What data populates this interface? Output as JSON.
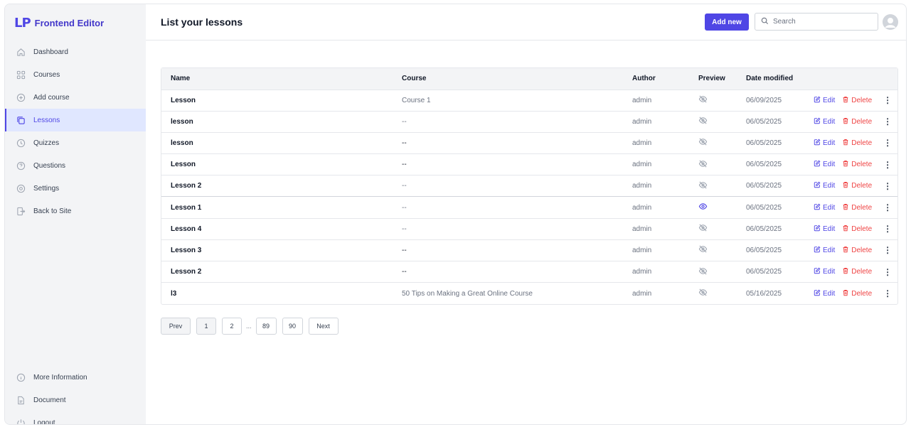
{
  "app": {
    "logo_mark": "LP",
    "logo_name": "Frontend Editor"
  },
  "sidebar": {
    "items": [
      {
        "label": "Dashboard",
        "icon": "home-icon"
      },
      {
        "label": "Courses",
        "icon": "grid-icon"
      },
      {
        "label": "Add course",
        "icon": "plus-circle-icon"
      },
      {
        "label": "Lessons",
        "icon": "copy-icon",
        "active": true
      },
      {
        "label": "Quizzes",
        "icon": "clock-icon"
      },
      {
        "label": "Questions",
        "icon": "question-circle-icon"
      },
      {
        "label": "Settings",
        "icon": "gear-icon"
      },
      {
        "label": "Back to Site",
        "icon": "exit-icon"
      }
    ],
    "bottom_items": [
      {
        "label": "More Information",
        "icon": "info-icon"
      },
      {
        "label": "Document",
        "icon": "document-icon"
      },
      {
        "label": "Logout",
        "icon": "power-icon"
      }
    ]
  },
  "header": {
    "title": "List your lessons",
    "add_label": "Add new",
    "search_placeholder": "Search"
  },
  "table": {
    "columns": [
      "Name",
      "Course",
      "Author",
      "Preview",
      "Date modified"
    ],
    "edit_label": "Edit",
    "delete_label": "Delete",
    "rows": [
      {
        "name": "Lesson",
        "course": "Course 1",
        "author": "admin",
        "preview": "hidden",
        "date": "06/09/2025"
      },
      {
        "name": "lesson",
        "course": "--",
        "author": "admin",
        "preview": "hidden",
        "date": "06/05/2025"
      },
      {
        "name": "lesson",
        "course": "--",
        "author": "admin",
        "preview": "hidden",
        "date": "06/05/2025"
      },
      {
        "name": "Lesson",
        "course": "--",
        "author": "admin",
        "preview": "hidden",
        "date": "06/05/2025"
      },
      {
        "name": "Lesson 2",
        "course": "--",
        "author": "admin",
        "preview": "hidden",
        "date": "06/05/2025"
      },
      {
        "name": "Lesson 1",
        "course": "--",
        "author": "admin",
        "preview": "visible",
        "date": "06/05/2025"
      },
      {
        "name": "Lesson 4",
        "course": "--",
        "author": "admin",
        "preview": "hidden",
        "date": "06/05/2025"
      },
      {
        "name": "Lesson 3",
        "course": "--",
        "author": "admin",
        "preview": "hidden",
        "date": "06/05/2025"
      },
      {
        "name": "Lesson 2",
        "course": "--",
        "author": "admin",
        "preview": "hidden",
        "date": "06/05/2025"
      },
      {
        "name": "l3",
        "course": "50 Tips on Making a Great Online Course",
        "author": "admin",
        "preview": "hidden",
        "date": "05/16/2025"
      }
    ]
  },
  "pagination": {
    "prev": "Prev",
    "pages": [
      "1",
      "2",
      "89",
      "90"
    ],
    "ellipsis": "...",
    "next": "Next",
    "current": "1"
  },
  "colors": {
    "accent": "#4f46e5",
    "danger": "#ef4444",
    "sidebar_bg": "#f3f4f6"
  }
}
